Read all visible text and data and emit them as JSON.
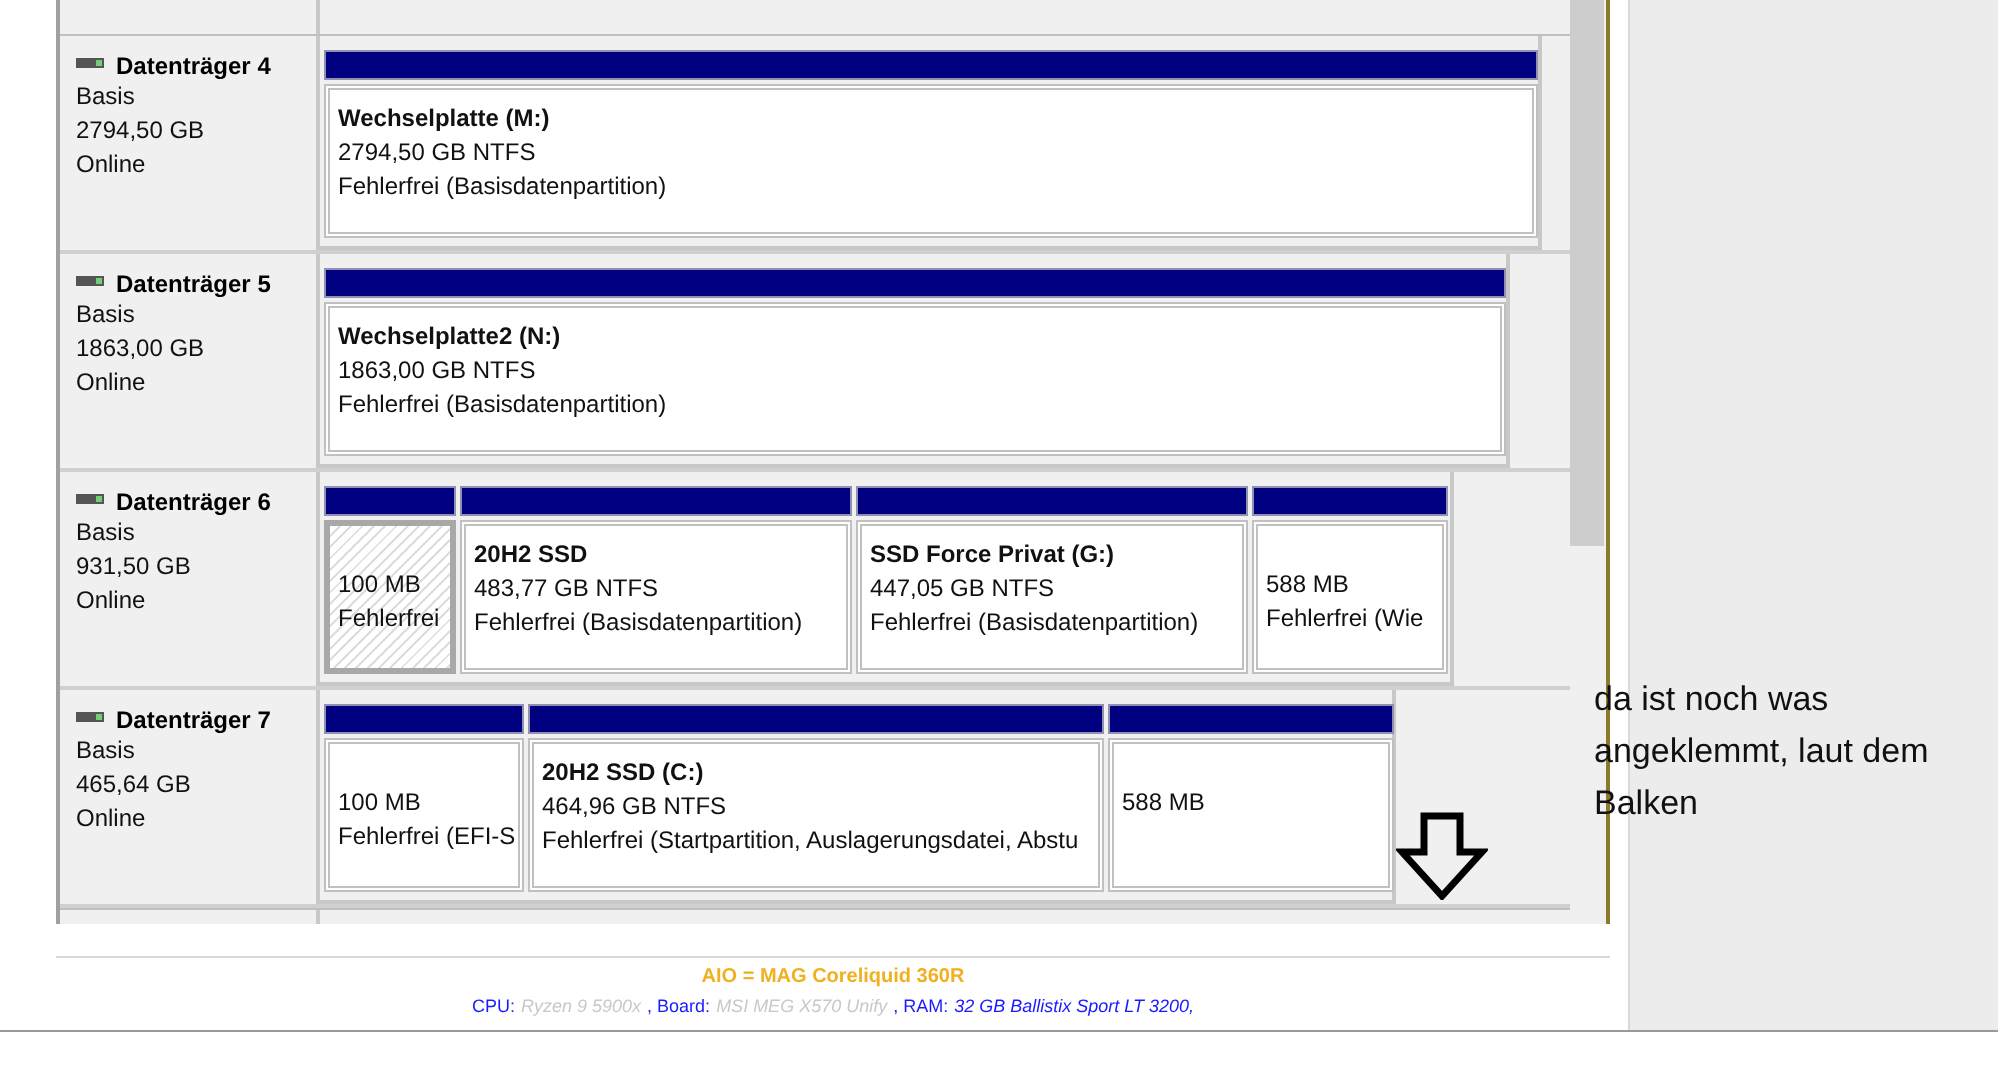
{
  "disks": [
    {
      "name": "Datenträger 4",
      "type": "Basis",
      "size": "2794,50 GB",
      "status": "Online",
      "partitions": [
        {
          "title": "Wechselplatte  (M:)",
          "size": "2794,50 GB NTFS",
          "state": "Fehlerfrei (Basisdatenpartition)",
          "selected": false
        }
      ]
    },
    {
      "name": "Datenträger 5",
      "type": "Basis",
      "size": "1863,00 GB",
      "status": "Online",
      "partitions": [
        {
          "title": "Wechselplatte2  (N:)",
          "size": "1863,00 GB NTFS",
          "state": "Fehlerfrei (Basisdatenpartition)",
          "selected": false
        }
      ]
    },
    {
      "name": "Datenträger 6",
      "type": "Basis",
      "size": "931,50 GB",
      "status": "Online",
      "partitions": [
        {
          "size": "100 MB",
          "state": "Fehlerfrei",
          "selected": true
        },
        {
          "title": "20H2 SSD",
          "size": "483,77 GB NTFS",
          "state": "Fehlerfrei (Basisdatenpartition)",
          "selected": false
        },
        {
          "title": "SSD Force Privat  (G:)",
          "size": "447,05 GB NTFS",
          "state": "Fehlerfrei (Basisdatenpartition)",
          "selected": false
        },
        {
          "size": "588 MB",
          "state": "Fehlerfrei (Wie",
          "selected": false
        }
      ]
    },
    {
      "name": "Datenträger 7",
      "type": "Basis",
      "size": "465,64 GB",
      "status": "Online",
      "partitions": [
        {
          "size": "100 MB",
          "state": "Fehlerfrei (EFI-S",
          "selected": false
        },
        {
          "title": "20H2 SSD  (C:)",
          "size": "464,96 GB NTFS",
          "state": "Fehlerfrei (Startpartition, Auslagerungsdatei, Abstu",
          "selected": false
        },
        {
          "size": "588 MB",
          "selected": false
        }
      ]
    }
  ],
  "annotation": "da ist noch was angeklemmt, laut dem Balken",
  "signature": {
    "headline": "AIO = MAG Coreliquid 360R",
    "specs": [
      {
        "kind": "label",
        "text": "CPU:"
      },
      {
        "kind": "muted",
        "text": "Ryzen 9 5900x"
      },
      {
        "kind": "label",
        "text": ", Board:"
      },
      {
        "kind": "muted",
        "text": "MSI MEG X570 Unify"
      },
      {
        "kind": "label",
        "text": ", RAM:"
      },
      {
        "kind": "value",
        "text": "32 GB Ballistix Sport LT 3200,"
      }
    ]
  }
}
